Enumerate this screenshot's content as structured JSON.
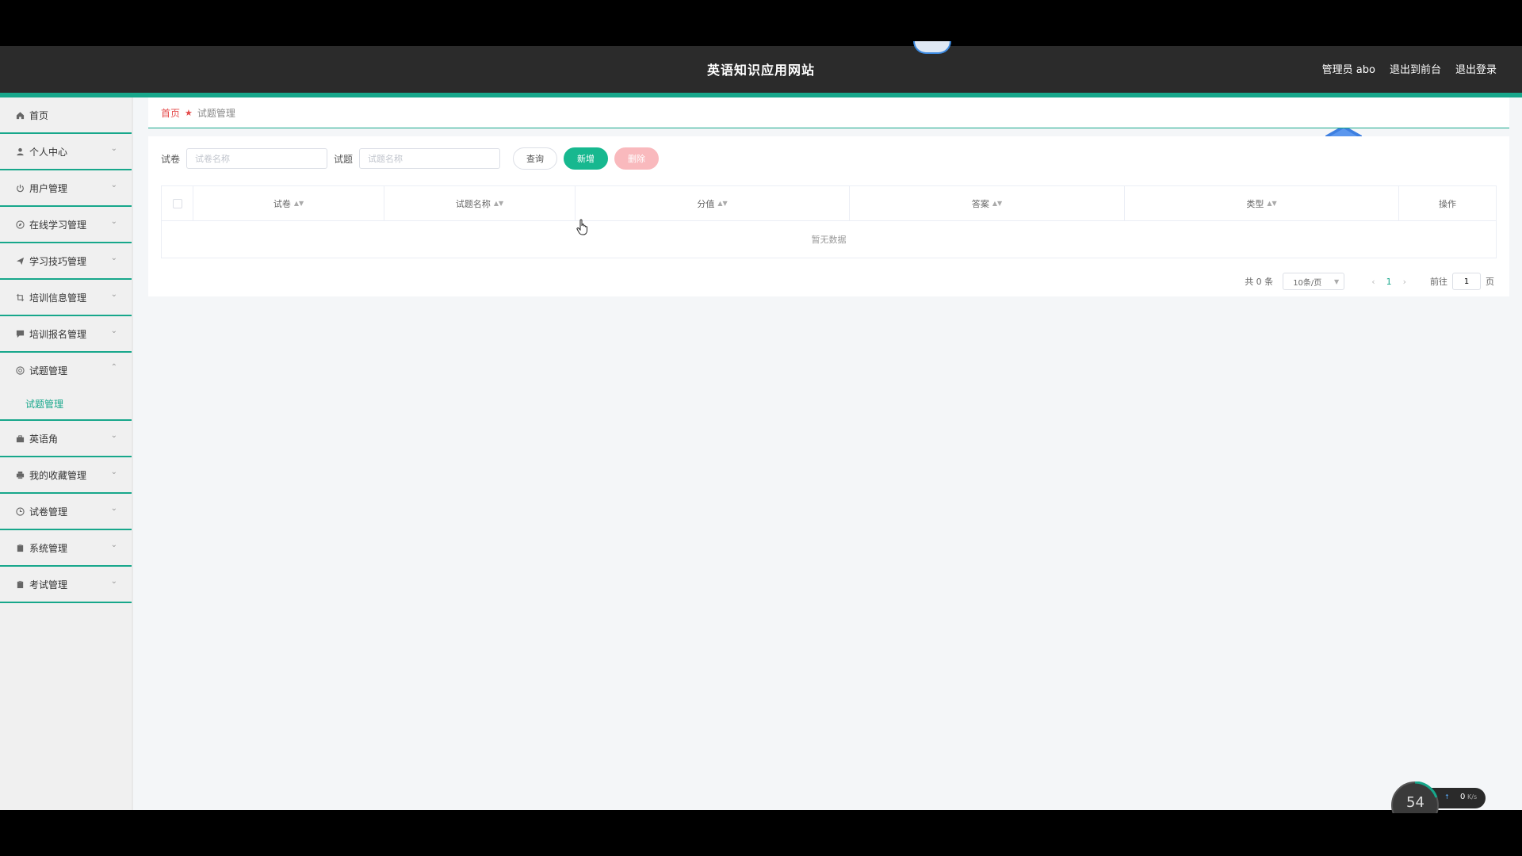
{
  "header": {
    "title": "英语知识应用网站",
    "user_label": "管理员 abo",
    "to_frontend": "退出到前台",
    "logout": "退出登录"
  },
  "sidebar": {
    "items": [
      {
        "label": "首页",
        "icon": "home-icon"
      },
      {
        "label": "个人中心",
        "icon": "user-icon"
      },
      {
        "label": "用户管理",
        "icon": "power-icon"
      },
      {
        "label": "在线学习管理",
        "icon": "compass-icon"
      },
      {
        "label": "学习技巧管理",
        "icon": "send-icon"
      },
      {
        "label": "培训信息管理",
        "icon": "crop-icon"
      },
      {
        "label": "培训报名管理",
        "icon": "chat-icon"
      },
      {
        "label": "试题管理",
        "icon": "circle-icon",
        "expanded": true,
        "children": [
          "试题管理"
        ]
      },
      {
        "label": "英语角",
        "icon": "briefcase-icon"
      },
      {
        "label": "我的收藏管理",
        "icon": "printer-icon"
      },
      {
        "label": "试卷管理",
        "icon": "clock-icon"
      },
      {
        "label": "系统管理",
        "icon": "clipboard-icon"
      },
      {
        "label": "考试管理",
        "icon": "clipboard-icon"
      }
    ]
  },
  "breadcrumb": {
    "home": "首页",
    "current": "试题管理"
  },
  "search": {
    "paper_label": "试卷",
    "paper_placeholder": "试卷名称",
    "question_label": "试题",
    "question_placeholder": "试题名称",
    "query_btn": "查询",
    "add_btn": "新增",
    "delete_btn": "删除"
  },
  "table": {
    "columns": [
      "试卷",
      "试题名称",
      "分值",
      "答案",
      "类型",
      "操作"
    ],
    "empty_text": "暂无数据"
  },
  "pagination": {
    "total": "共 0 条",
    "page_size": "10条/页",
    "current_page": "1",
    "goto_label": "前往",
    "goto_value": "1",
    "page_suffix": "页"
  },
  "net_widget": {
    "percent": "54",
    "speed": "0",
    "unit": "K/s"
  },
  "colors": {
    "accent": "#17a78b",
    "add_button": "#17b88f",
    "delete_button": "#f9b9bd",
    "header_bg": "#2b2b2b"
  }
}
